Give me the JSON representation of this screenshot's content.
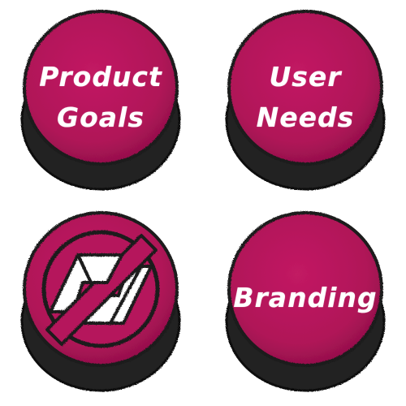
{
  "colors": {
    "button_face": "#b9155c",
    "button_edge": "#8a0f46",
    "shadow": "#232323",
    "outline": "#1a1a1a",
    "text": "#ffffff"
  },
  "buttons": [
    {
      "id": "product-goals",
      "lines": [
        "Product",
        "Goals"
      ]
    },
    {
      "id": "user-needs",
      "lines": [
        "User",
        "Needs"
      ]
    },
    {
      "id": "logo",
      "icon": "stylized-s-logo-icon"
    },
    {
      "id": "branding",
      "lines": [
        "Branding"
      ]
    }
  ]
}
